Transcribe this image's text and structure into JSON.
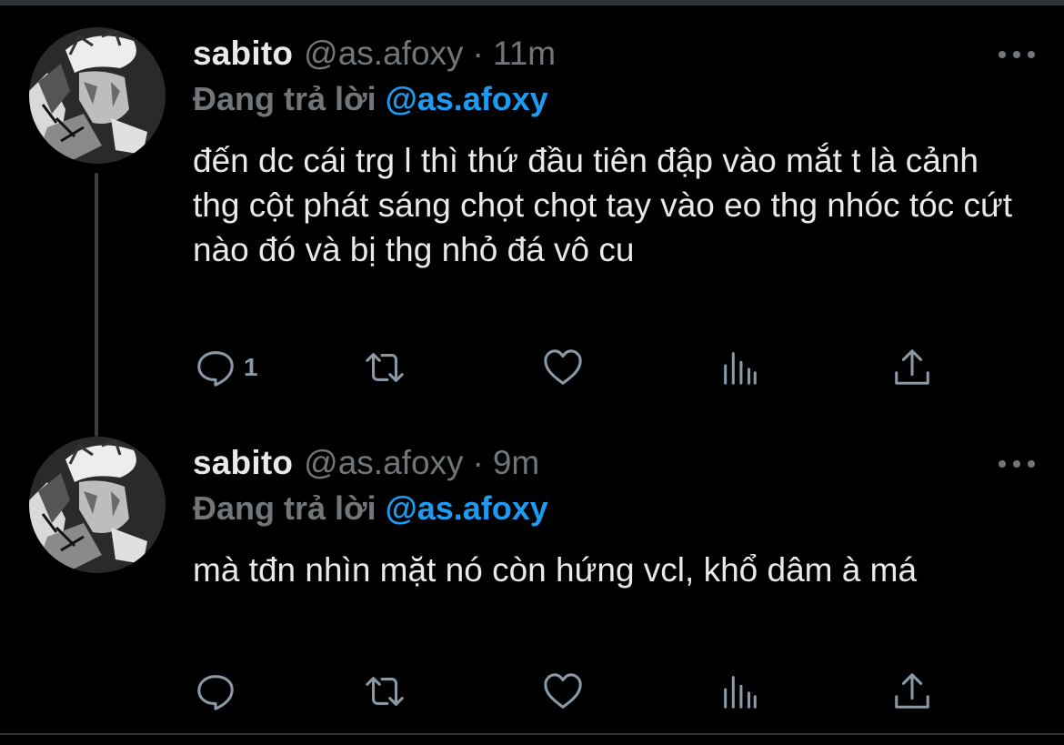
{
  "tweets": [
    {
      "display_name": "sabito",
      "handle": "@as.afoxy",
      "separator": "·",
      "time": "11m",
      "reply_label": "Đang trả lời",
      "reply_to": "@as.afoxy",
      "text": "đến dc cái trg l thì thứ đầu tiên đập vào mắt t là cảnh thg cột phát sáng chọt chọt tay vào eo thg nhóc tóc cứt nào đó và bị thg nhỏ đá vô cu",
      "reply_count": "1",
      "icons": [
        "reply-icon",
        "retweet-icon",
        "like-icon",
        "views-icon",
        "share-icon",
        "more-icon"
      ]
    },
    {
      "display_name": "sabito",
      "handle": "@as.afoxy",
      "separator": "·",
      "time": "9m",
      "reply_label": "Đang trả lời",
      "reply_to": "@as.afoxy",
      "text": "mà tđn nhìn mặt nó còn hứng vcl, khổ dâm à má",
      "reply_count": "",
      "icons": [
        "reply-icon",
        "retweet-icon",
        "like-icon",
        "views-icon",
        "share-icon",
        "more-icon"
      ]
    }
  ],
  "colors": {
    "background": "#000000",
    "text_primary": "#e7e9ea",
    "text_secondary": "#71767b",
    "accent": "#1d9bf0",
    "icon": "#8b98a5",
    "divider": "#2f3336"
  }
}
